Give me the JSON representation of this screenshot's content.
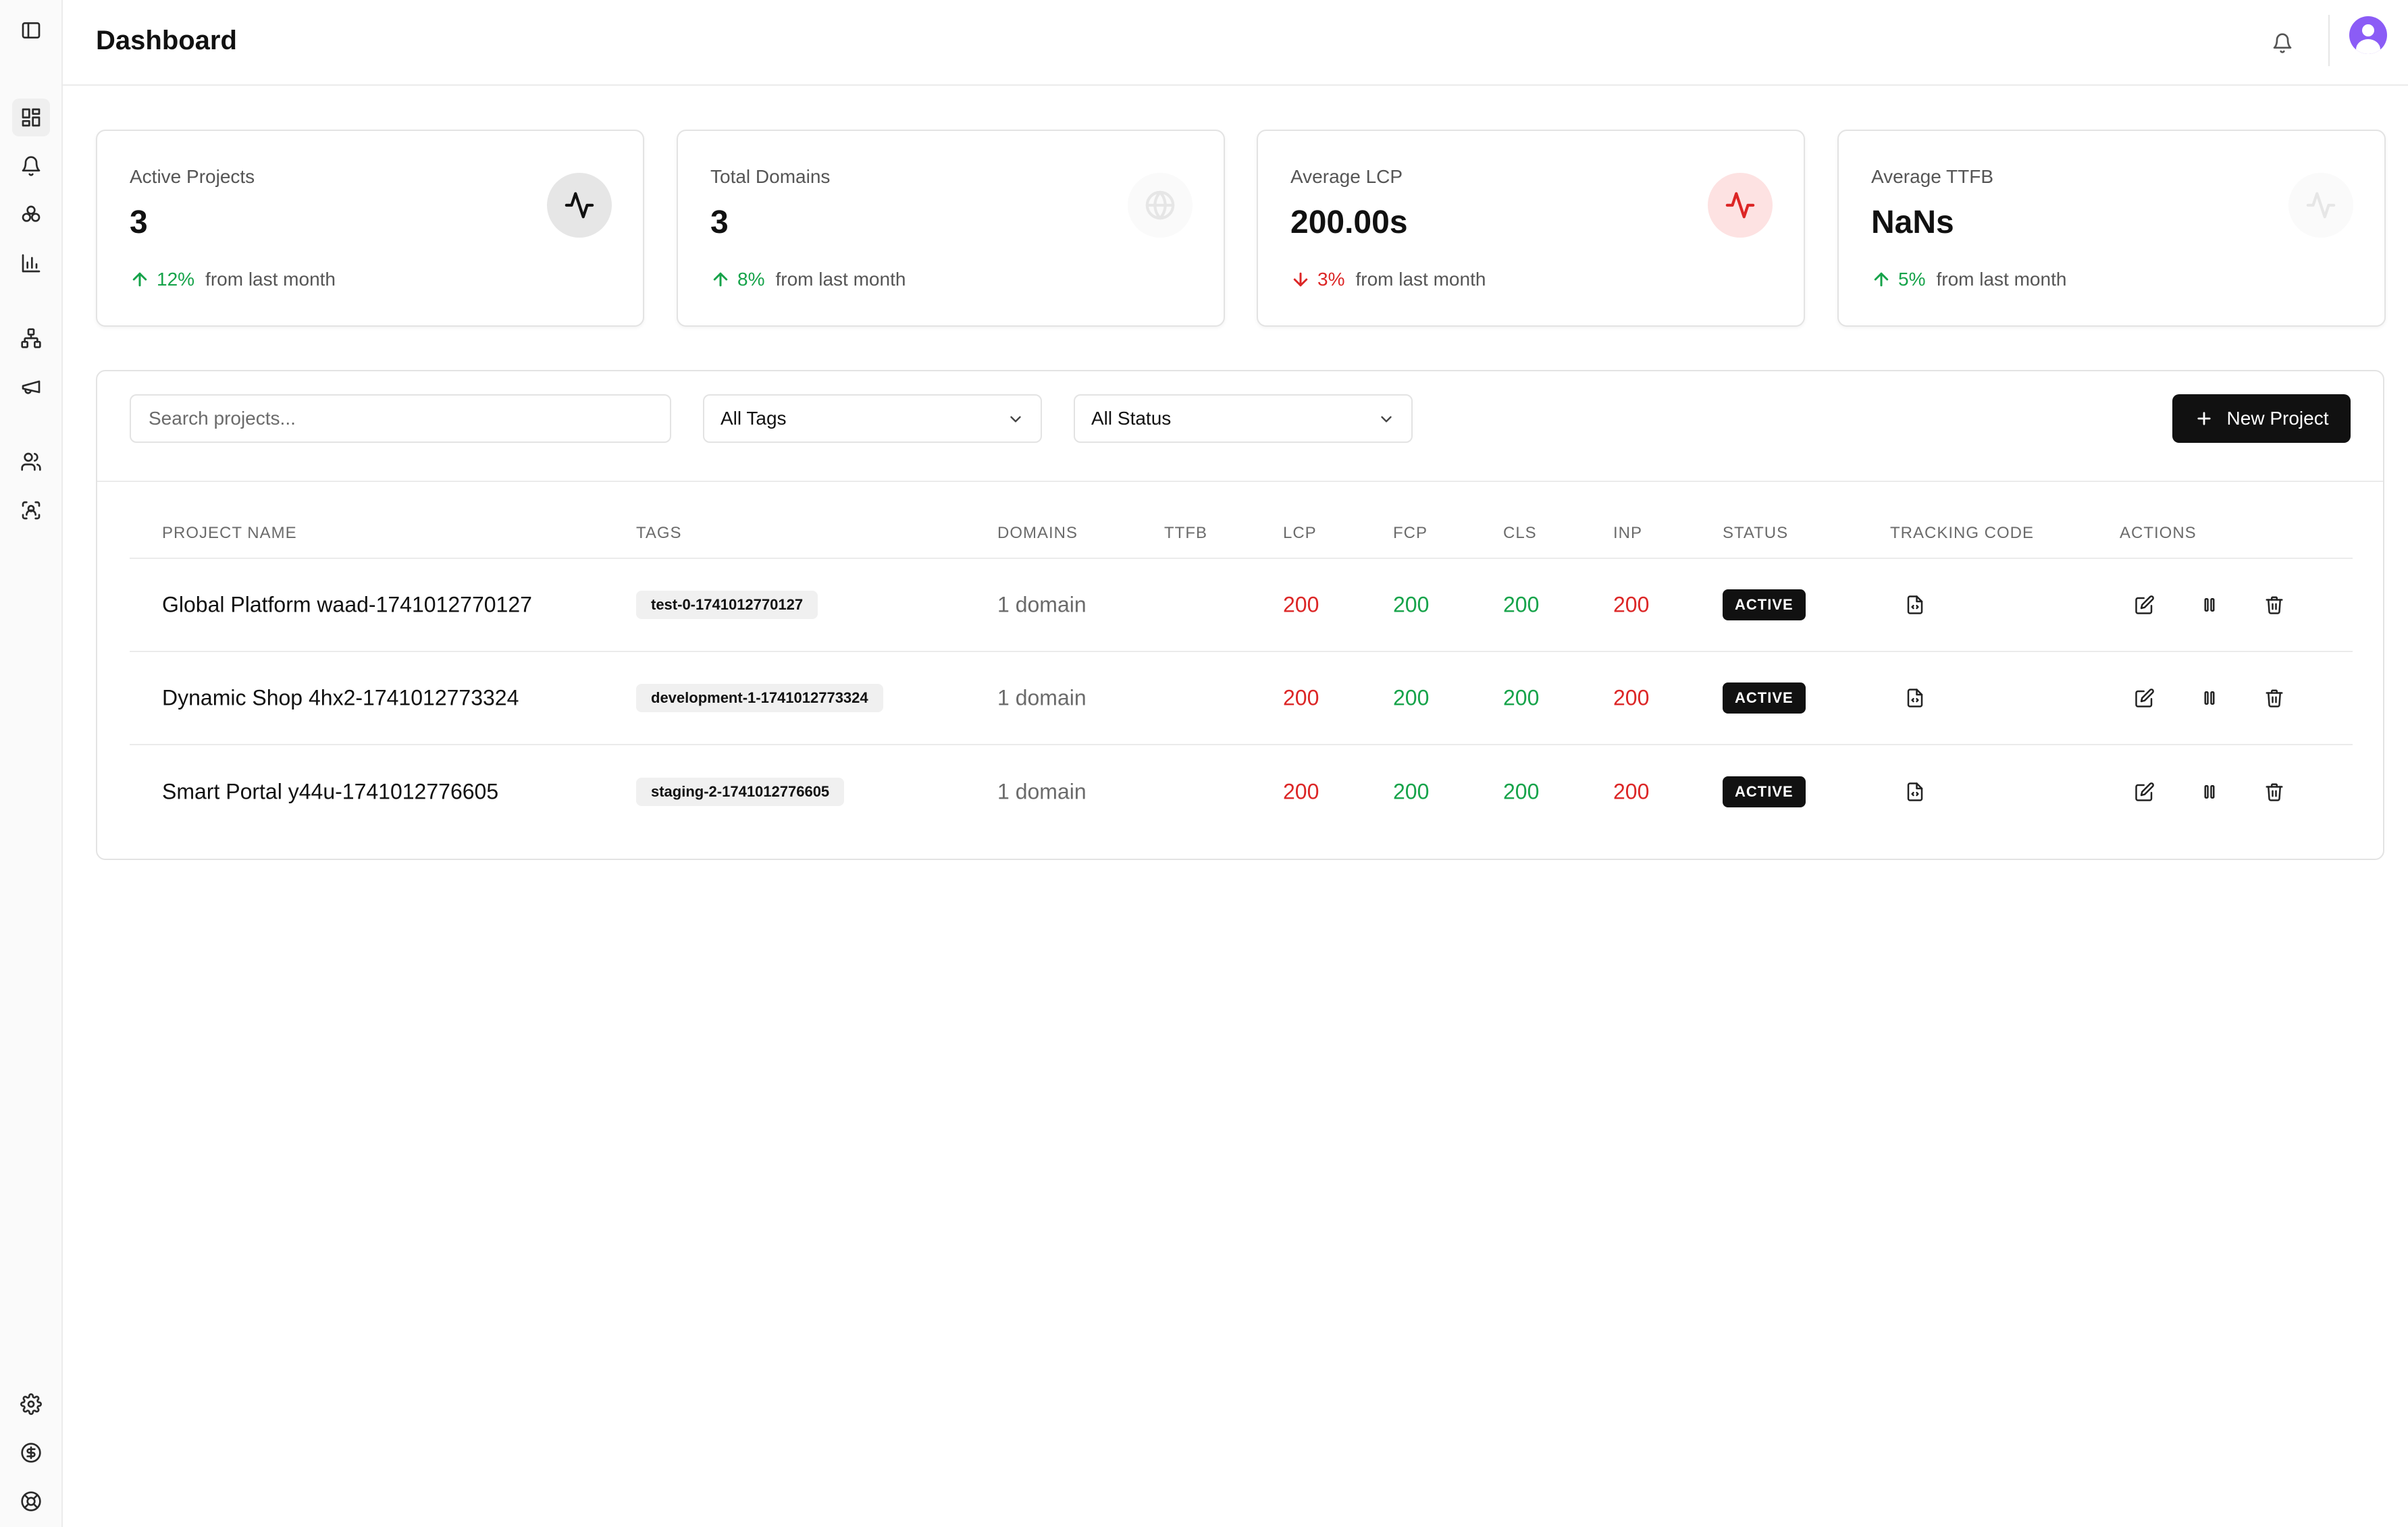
{
  "header": {
    "title": "Dashboard"
  },
  "sidebar": {
    "top_icons": [
      "sidebar-toggle-icon"
    ],
    "nav_items": [
      {
        "icon": "dashboard-grid-icon",
        "active": true
      },
      {
        "icon": "bell-icon",
        "active": false
      },
      {
        "icon": "integrations-icon",
        "active": false
      },
      {
        "icon": "bar-chart-icon",
        "active": false
      },
      {
        "icon": "sitemap-icon",
        "active": false
      },
      {
        "icon": "megaphone-icon",
        "active": false
      },
      {
        "icon": "users-icon",
        "active": false
      },
      {
        "icon": "scan-face-icon",
        "active": false
      }
    ],
    "bottom_items": [
      {
        "icon": "gear-icon"
      },
      {
        "icon": "dollar-circle-icon"
      },
      {
        "icon": "lifebuoy-icon"
      }
    ]
  },
  "stats": [
    {
      "label": "Active Projects",
      "value": "3",
      "trend": "up",
      "change": "12%",
      "suffix": "from last month",
      "icon": "activity-icon",
      "icon_style": "gray"
    },
    {
      "label": "Total Domains",
      "value": "3",
      "trend": "up",
      "change": "8%",
      "suffix": "from last month",
      "icon": "globe-icon",
      "icon_style": "faint"
    },
    {
      "label": "Average LCP",
      "value": "200.00s",
      "trend": "down",
      "change": "3%",
      "suffix": "from last month",
      "icon": "activity-icon",
      "icon_style": "red"
    },
    {
      "label": "Average TTFB",
      "value": "NaNs",
      "trend": "up",
      "change": "5%",
      "suffix": "from last month",
      "icon": "activity-icon",
      "icon_style": "faint"
    }
  ],
  "toolbar": {
    "search_placeholder": "Search projects...",
    "tags_filter": "All Tags",
    "status_filter": "All Status",
    "new_project_label": "New Project"
  },
  "table": {
    "columns": [
      "PROJECT NAME",
      "TAGS",
      "DOMAINS",
      "TTFB",
      "LCP",
      "FCP",
      "CLS",
      "INP",
      "STATUS",
      "TRACKING CODE",
      "ACTIONS"
    ],
    "rows": [
      {
        "name": "Global Platform waad-1741012770127",
        "tag": "test-0-1741012770127",
        "domains": "1 domain",
        "ttfb": "",
        "lcp": "200",
        "fcp": "200",
        "cls": "200",
        "inp": "200",
        "status": "ACTIVE"
      },
      {
        "name": "Dynamic Shop 4hx2-1741012773324",
        "tag": "development-1-1741012773324",
        "domains": "1 domain",
        "ttfb": "",
        "lcp": "200",
        "fcp": "200",
        "cls": "200",
        "inp": "200",
        "status": "ACTIVE"
      },
      {
        "name": "Smart Portal y44u-1741012776605",
        "tag": "staging-2-1741012776605",
        "domains": "1 domain",
        "ttfb": "",
        "lcp": "200",
        "fcp": "200",
        "cls": "200",
        "inp": "200",
        "status": "ACTIVE"
      }
    ]
  },
  "colors": {
    "good": "#16a34a",
    "poor": "#dc2626",
    "primary_button": "#111111",
    "avatar": "#8b5cf6"
  }
}
